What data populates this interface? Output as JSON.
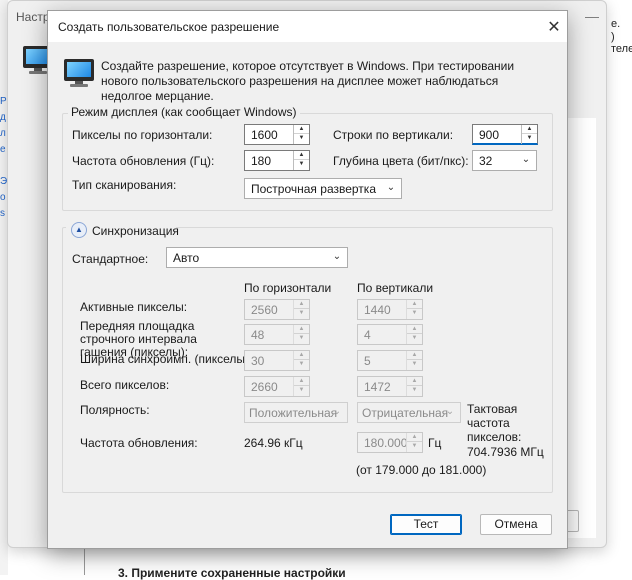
{
  "background": {
    "window_title": "Настр",
    "minimize_glyph": "—",
    "left_links": [
      "Р",
      "д",
      "л",
      "е",
      "Э",
      "о",
      "s"
    ],
    "right_lines": [
      "е.",
      ") теле"
    ],
    "bottom_text": "3. Примените сохраненные настройки"
  },
  "dialog": {
    "title": "Создать пользовательское разрешение",
    "close_glyph": "✕",
    "intro": "Создайте разрешение, которое отсутствует в Windows. При тестировании нового пользовательского разрешения на дисплее может наблюдаться недолгое мерцание.",
    "display_mode": {
      "legend": "Режим дисплея (как сообщает Windows)",
      "h_pixels_label": "Пикселы по горизонтали:",
      "h_pixels_value": "1600",
      "v_lines_label": "Строки по вертикали:",
      "v_lines_value": "900",
      "refresh_label": "Частота обновления (Гц):",
      "refresh_value": "180",
      "color_depth_label": "Глубина цвета (бит/пкс):",
      "color_depth_value": "32",
      "scan_label": "Тип сканирования:",
      "scan_value": "Построчная развертка"
    },
    "sync": {
      "header": "Синхронизация",
      "standard_label": "Стандартное:",
      "standard_value": "Авто",
      "col_h": "По горизонтали",
      "col_v": "По вертикали",
      "rows": [
        {
          "label": "Активные пикселы:",
          "h": "2560",
          "v": "1440"
        },
        {
          "label": "Передняя площадка строчного интервала гашения (пикселы):",
          "h": "48",
          "v": "4"
        },
        {
          "label": "Ширина синхроимп. (пикселы):",
          "h": "30",
          "v": "5"
        },
        {
          "label": "Всего пикселов:",
          "h": "2660",
          "v": "1472"
        }
      ],
      "polarity_label": "Полярность:",
      "polarity_h": "Положительная",
      "polarity_v": "Отрицательная",
      "pixel_clock_label": "Тактовая частота пикселов:",
      "pixel_clock_value": "704.7936 МГц",
      "refresh_label": "Частота обновления:",
      "refresh_h": "264.96 кГц",
      "refresh_v": "180.000",
      "refresh_unit": "Гц",
      "range": "(от 179.000 до 181.000)"
    },
    "buttons": {
      "test": "Тест",
      "cancel": "Отмена"
    }
  }
}
